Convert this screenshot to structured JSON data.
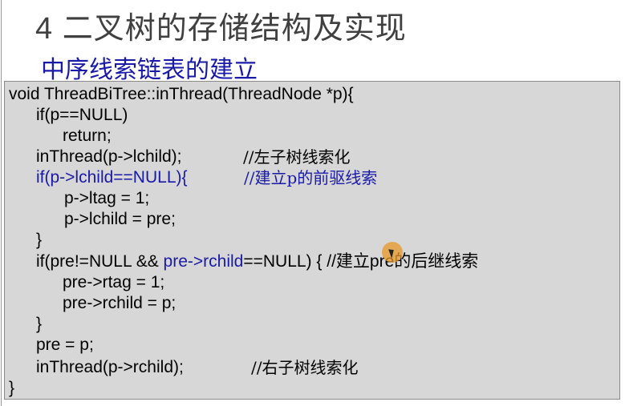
{
  "slide": {
    "title": "4 二叉树的存储结构及实现",
    "subtitle": "中序线索链表的建立"
  },
  "code": {
    "l1": "void ThreadBiTree::inThread(ThreadNode *p){",
    "l2": "if(p==NULL)",
    "l3": "return;",
    "l4": "inThread(p->lchild);",
    "l4_comment": "//左子树线索化",
    "l5": "if(p->lchild==NULL){",
    "l5_comment": "//建立p的前驱线索",
    "l6": "p->ltag = 1;",
    "l7": "p->lchild = pre;",
    "l8": "}",
    "l9_a": "if(pre!=NULL && ",
    "l9_b": "pre->rchild",
    "l9_c": "==NULL) { //建立pre的后继线索",
    "l10": "pre->rtag = 1;",
    "l11": "pre->rchild = p;",
    "l12": "}",
    "l13": "pre = p;",
    "l14": "inThread(p->rchild);",
    "l14_comment": "//右子树线索化",
    "l15": "}"
  },
  "colors": {
    "title": "#404040",
    "subtitle": "#1a1aa8",
    "highlight": "#1a1aa8",
    "code_bg": "#d7d7d7"
  }
}
